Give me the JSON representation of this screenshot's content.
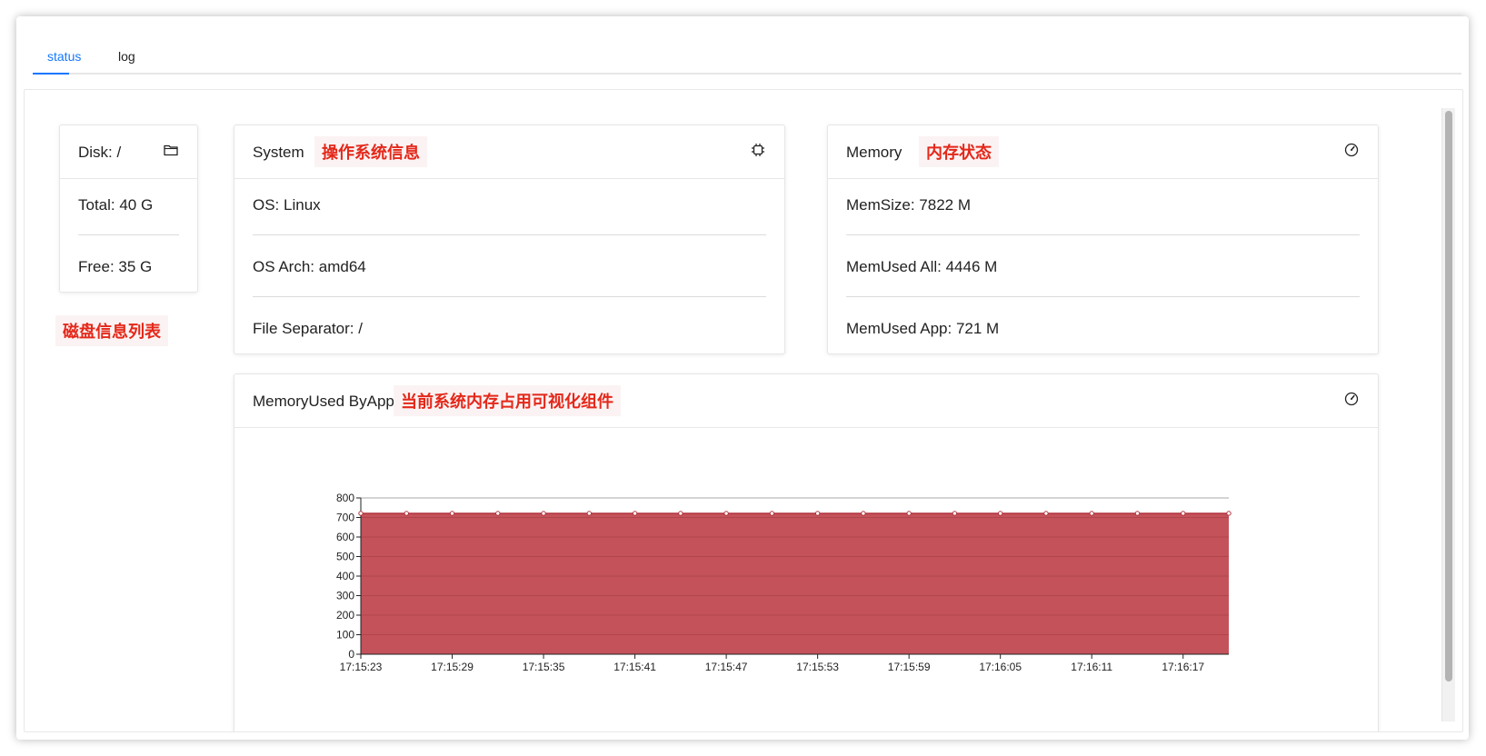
{
  "tabs": [
    {
      "label": "status",
      "active": true
    },
    {
      "label": "log",
      "active": false
    }
  ],
  "disk_card": {
    "title": "Disk: /",
    "icon": "folder-icon",
    "rows": [
      "Total: 40 G",
      "Free: 35 G"
    ],
    "annotation": "磁盘信息列表"
  },
  "system_card": {
    "title": "System",
    "annotation": "操作系统信息",
    "icon": "chip-icon",
    "rows": [
      "OS: Linux",
      "OS Arch: amd64",
      "File Separator: /"
    ]
  },
  "memory_card": {
    "title": "Memory",
    "annotation": "内存状态",
    "icon": "gauge-icon",
    "rows": [
      "MemSize: 7822 M",
      "MemUsed All: 4446 M",
      "MemUsed App: 721 M"
    ]
  },
  "chart_card": {
    "title": "MemoryUsed ByApp",
    "annotation": "当前系统内存占用可视化组件",
    "icon": "gauge-icon"
  },
  "colors": {
    "accent": "#1677ff",
    "annotation": "#e4281a",
    "area_fill": "#c4525a",
    "area_line": "#b0323c"
  },
  "chart_data": {
    "type": "area",
    "title": "",
    "xlabel": "",
    "ylabel": "",
    "ylim": [
      0,
      800
    ],
    "yticks": [
      0,
      100,
      200,
      300,
      400,
      500,
      600,
      700,
      800
    ],
    "x_tick_labels": [
      "17:15:23",
      "17:15:29",
      "17:15:35",
      "17:15:41",
      "17:15:47",
      "17:15:53",
      "17:15:59",
      "17:16:05",
      "17:16:11",
      "17:16:17"
    ],
    "series": [
      {
        "values": [
          721,
          721,
          721,
          721,
          721,
          721,
          721,
          721,
          721,
          721,
          721,
          721,
          721,
          721,
          721,
          721,
          721,
          721,
          721,
          721
        ]
      }
    ],
    "grid": true,
    "legend": "none"
  }
}
